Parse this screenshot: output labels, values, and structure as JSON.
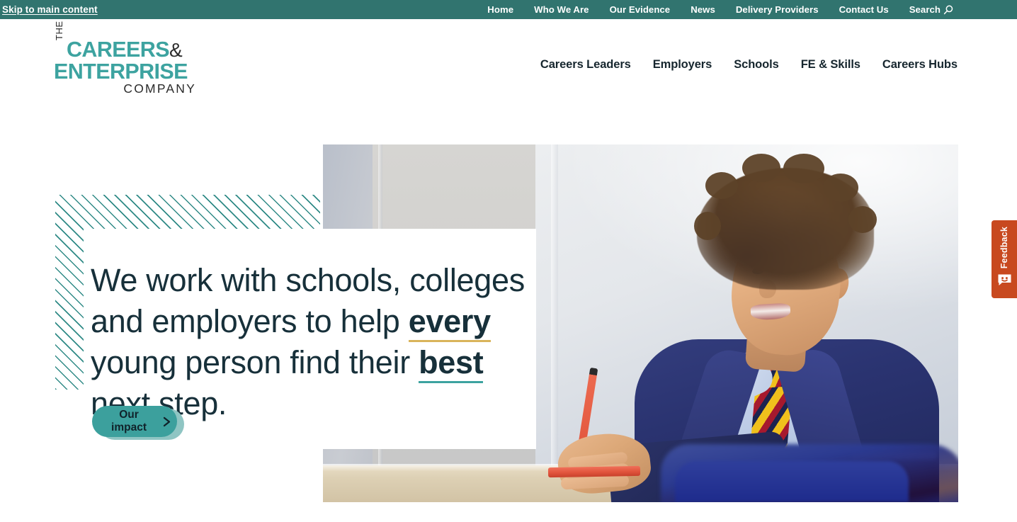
{
  "utility_bar": {
    "skip_link": "Skip to main content",
    "nav": [
      {
        "label": "Home"
      },
      {
        "label": "Who We Are"
      },
      {
        "label": "Our Evidence"
      },
      {
        "label": "News"
      },
      {
        "label": "Delivery Providers"
      },
      {
        "label": "Contact Us"
      },
      {
        "label": "Search",
        "icon": "search-icon"
      }
    ],
    "background_color": "#31746f"
  },
  "logo": {
    "the": "THE",
    "line1": "CAREERS",
    "ampersand": "&",
    "line2": "ENTERPRISE",
    "line3": "COMPANY",
    "teal": "#3da3a0",
    "dark": "#2b2b2b"
  },
  "main_nav": {
    "items": [
      {
        "label": "Careers Leaders"
      },
      {
        "label": "Employers"
      },
      {
        "label": "Schools"
      },
      {
        "label": "FE & Skills"
      },
      {
        "label": "Careers Hubs"
      }
    ]
  },
  "hero": {
    "headline": {
      "part1": "We work with schools, colleges and employers to help ",
      "emphasis1": "every",
      "part2": " young person find their ",
      "emphasis2": "best",
      "part3": " next step."
    },
    "emphasis1_underline_color": "#d9b45b",
    "emphasis2_underline_color": "#3da3a0",
    "cta": {
      "label": "Our impact",
      "icon": "chevron-right-icon",
      "background_color": "#3ca09d"
    },
    "photo_alt": "Secondary school pupil in navy blazer and striped tie writing with an orange pen at a classroom desk",
    "hatch_color": "#2f8a86"
  },
  "feedback_tab": {
    "label": "Feedback",
    "icon": "smiley-speech-bubble-icon",
    "background_color": "#c8491f"
  }
}
